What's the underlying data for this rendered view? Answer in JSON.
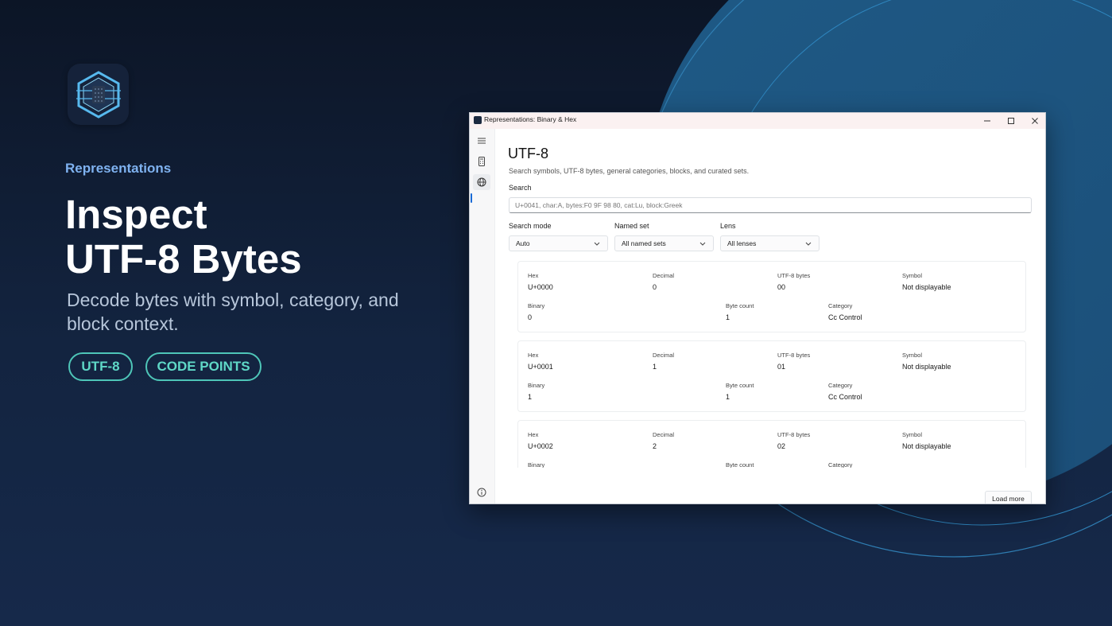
{
  "promo": {
    "eyebrow": "Representations",
    "headline": [
      "Inspect",
      "UTF-8 Bytes"
    ],
    "subhead": "Decode bytes with symbol, category, and block context.",
    "pills": [
      "UTF-8",
      "CODE POINTS"
    ]
  },
  "window": {
    "title": "Representations: Binary & Hex",
    "controls": {
      "minimize": "—",
      "maximize": "☐",
      "close": "✕"
    }
  },
  "page": {
    "title": "UTF-8",
    "description": "Search symbols, UTF-8 bytes, general categories, blocks, and curated sets.",
    "search_label": "Search",
    "search_placeholder": "U+0041, char:A, bytes:F0 9F 98 80, cat:Lu, block:Greek",
    "filters": [
      {
        "label": "Search mode",
        "value": "Auto"
      },
      {
        "label": "Named set",
        "value": "All named sets"
      },
      {
        "label": "Lens",
        "value": "All lenses"
      }
    ],
    "field_labels": {
      "hex": "Hex",
      "decimal": "Decimal",
      "utf8": "UTF-8 bytes",
      "symbol": "Symbol",
      "binary": "Binary",
      "byte_count": "Byte count",
      "category": "Category"
    },
    "results": [
      {
        "hex": "U+0000",
        "decimal": "0",
        "utf8": "00",
        "symbol": "Not displayable",
        "binary": "0",
        "byte_count": "1",
        "category": "Cc Control"
      },
      {
        "hex": "U+0001",
        "decimal": "1",
        "utf8": "01",
        "symbol": "Not displayable",
        "binary": "1",
        "byte_count": "1",
        "category": "Cc Control"
      },
      {
        "hex": "U+0002",
        "decimal": "2",
        "utf8": "02",
        "symbol": "Not displayable"
      }
    ],
    "load_more": "Load more"
  },
  "colors": {
    "accent": "#1a6bd6",
    "pill": "#4ec6b8",
    "eyebrow": "#7fb2f0"
  }
}
